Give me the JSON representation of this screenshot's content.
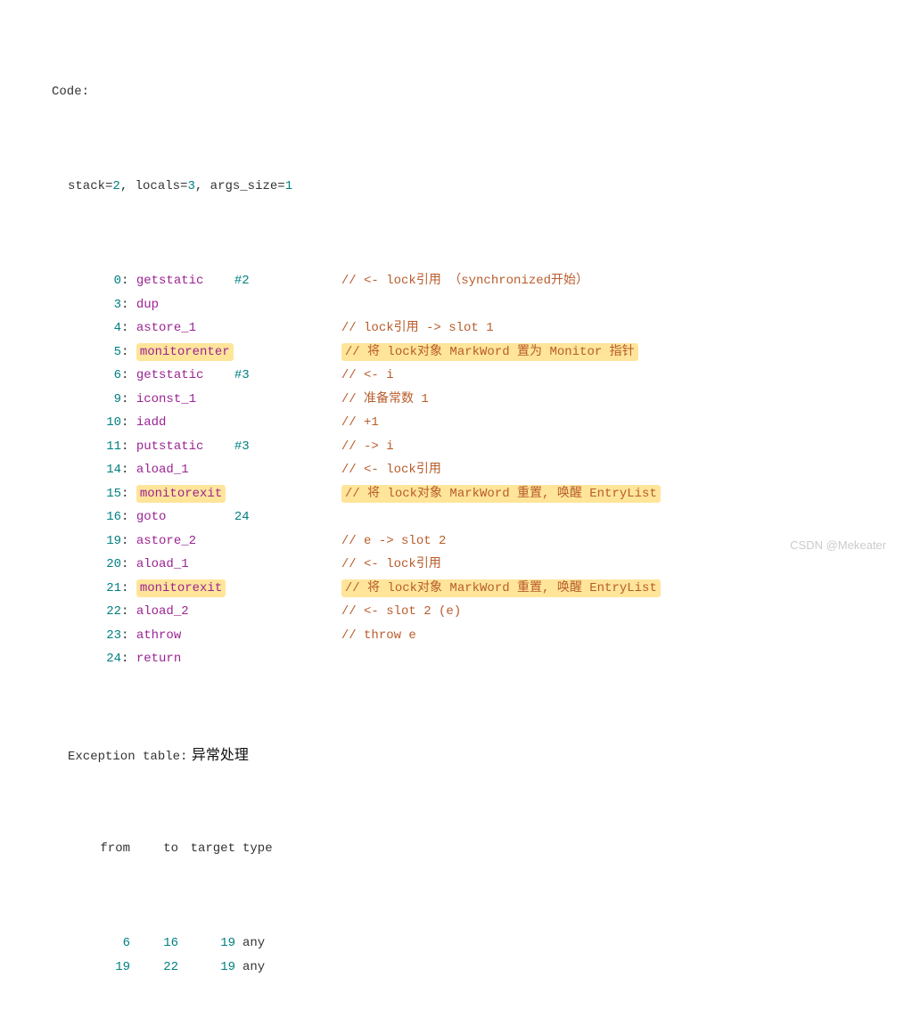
{
  "header": "Code:",
  "stack_line": {
    "prefix": "stack=",
    "stack": "2",
    "locals_label": ", locals=",
    "locals": "3",
    "args_label": ", args_size=",
    "args": "1"
  },
  "lines": [
    {
      "offset": "0",
      "instr": "getstatic",
      "operand": "#2",
      "comment": "// <- lock引用 （synchronized开始）",
      "hl": false
    },
    {
      "offset": "3",
      "instr": "dup",
      "operand": "",
      "comment": "",
      "hl": false
    },
    {
      "offset": "4",
      "instr": "astore_1",
      "operand": "",
      "comment": "// lock引用 -> slot 1",
      "hl": false
    },
    {
      "offset": "5",
      "instr": "monitorenter",
      "operand": "",
      "comment": "// 将 lock对象 MarkWord 置为 Monitor 指针",
      "hl": true
    },
    {
      "offset": "6",
      "instr": "getstatic",
      "operand": "#3",
      "comment": "// <- i",
      "hl": false
    },
    {
      "offset": "9",
      "instr": "iconst_1",
      "operand": "",
      "comment": "// 准备常数 1",
      "hl": false
    },
    {
      "offset": "10",
      "instr": "iadd",
      "operand": "",
      "comment": "// +1",
      "hl": false
    },
    {
      "offset": "11",
      "instr": "putstatic",
      "operand": "#3",
      "comment": "// -> i",
      "hl": false
    },
    {
      "offset": "14",
      "instr": "aload_1",
      "operand": "",
      "comment": "// <- lock引用",
      "hl": false
    },
    {
      "offset": "15",
      "instr": "monitorexit",
      "operand": "",
      "comment": "// 将 lock对象 MarkWord 重置, 唤醒 EntryList",
      "hl": true
    },
    {
      "offset": "16",
      "instr": "goto",
      "operand": "24",
      "comment": "",
      "hl": false
    },
    {
      "offset": "19",
      "instr": "astore_2",
      "operand": "",
      "comment": "// e -> slot 2",
      "hl": false
    },
    {
      "offset": "20",
      "instr": "aload_1",
      "operand": "",
      "comment": "// <- lock引用",
      "hl": false
    },
    {
      "offset": "21",
      "instr": "monitorexit",
      "operand": "",
      "comment": "// 将 lock对象 MarkWord 重置, 唤醒 EntryList",
      "hl": true
    },
    {
      "offset": "22",
      "instr": "aload_2",
      "operand": "",
      "comment": "// <- slot 2 (e)",
      "hl": false
    },
    {
      "offset": "23",
      "instr": "athrow",
      "operand": "",
      "comment": "// throw e",
      "hl": false
    },
    {
      "offset": "24",
      "instr": "return",
      "operand": "",
      "comment": "",
      "hl": false
    }
  ],
  "exc": {
    "label": "Exception table:",
    "chinese": " 异常处理",
    "cols": {
      "from": "from",
      "to": "to",
      "target": "target",
      "type": "type"
    },
    "rows": [
      {
        "from": "6",
        "to": "16",
        "target": "19",
        "type": "any"
      },
      {
        "from": "19",
        "to": "22",
        "target": "19",
        "type": "any"
      }
    ]
  },
  "watermark": "CSDN @Mekeater"
}
